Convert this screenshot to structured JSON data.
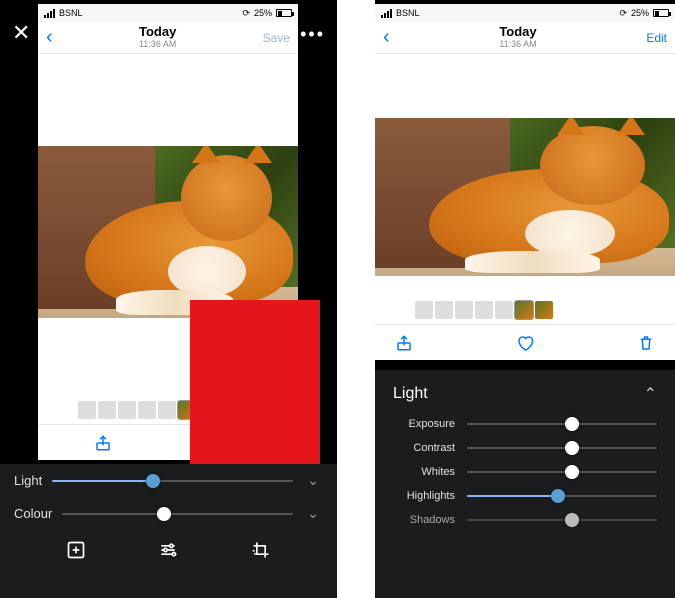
{
  "statusbar": {
    "carrier": "BSNL",
    "battery_pct": "25%"
  },
  "nav": {
    "title": "Today",
    "subtitle": "11:36 AM",
    "save": "Save",
    "edit": "Edit"
  },
  "left": {
    "sliders": {
      "light": {
        "label": "Light",
        "pct": 42
      },
      "colour": {
        "label": "Colour",
        "pct": 44
      }
    }
  },
  "right": {
    "section": "Light",
    "sliders": {
      "exposure": {
        "label": "Exposure",
        "pct": 55
      },
      "contrast": {
        "label": "Contrast",
        "pct": 55
      },
      "whites": {
        "label": "Whites",
        "pct": 55
      },
      "highlights": {
        "label": "Highlights",
        "pct": 48
      },
      "shadows": {
        "label": "Shadows",
        "pct": 55
      }
    }
  }
}
